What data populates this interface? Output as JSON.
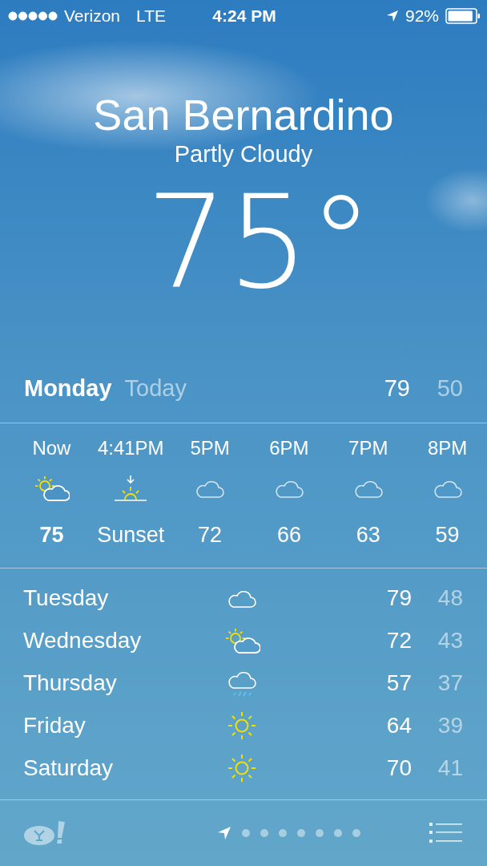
{
  "status_bar": {
    "carrier": "Verizon",
    "network": "LTE",
    "time": "4:24 PM",
    "battery": "92%"
  },
  "location": {
    "city": "San Bernardino",
    "condition": "Partly Cloudy",
    "temperature": "75°"
  },
  "today": {
    "day": "Monday",
    "label": "Today",
    "high": "79",
    "low": "50"
  },
  "hourly": [
    {
      "time": "Now",
      "kind": "partly-cloudy",
      "temp": "75",
      "current": true
    },
    {
      "time": "4:41PM",
      "kind": "sunset",
      "temp": "Sunset",
      "current": false
    },
    {
      "time": "5PM",
      "kind": "cloudy",
      "temp": "72",
      "current": false
    },
    {
      "time": "6PM",
      "kind": "cloudy",
      "temp": "66",
      "current": false
    },
    {
      "time": "7PM",
      "kind": "cloudy",
      "temp": "63",
      "current": false
    },
    {
      "time": "8PM",
      "kind": "cloudy",
      "temp": "59",
      "current": false
    }
  ],
  "daily": [
    {
      "day": "Tuesday",
      "kind": "cloudy",
      "high": "79",
      "low": "48"
    },
    {
      "day": "Wednesday",
      "kind": "partly-cloudy",
      "high": "72",
      "low": "43"
    },
    {
      "day": "Thursday",
      "kind": "rain",
      "high": "57",
      "low": "37"
    },
    {
      "day": "Friday",
      "kind": "sunny",
      "high": "64",
      "low": "39"
    },
    {
      "day": "Saturday",
      "kind": "sunny",
      "high": "70",
      "low": "41"
    }
  ],
  "pages": [
    {
      "kind": "location",
      "selected": true
    },
    {
      "kind": "dot",
      "selected": false
    },
    {
      "kind": "dot",
      "selected": false
    },
    {
      "kind": "dot",
      "selected": false
    },
    {
      "kind": "dot",
      "selected": false
    },
    {
      "kind": "dot",
      "selected": false
    },
    {
      "kind": "dot",
      "selected": false
    },
    {
      "kind": "dot",
      "selected": false
    }
  ]
}
